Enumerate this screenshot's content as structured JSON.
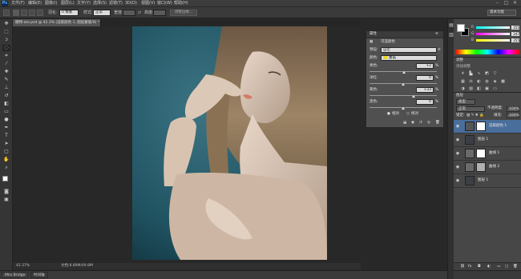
{
  "app": {
    "logo": "Ps"
  },
  "menu": [
    "文件(F)",
    "编辑(E)",
    "图像(I)",
    "图层(L)",
    "文字(Y)",
    "选择(S)",
    "滤镜(T)",
    "3D(D)",
    "视图(V)",
    "窗口(W)",
    "帮助(H)"
  ],
  "window_controls": {
    "minimize": "–",
    "maximize": "□",
    "close": "✕"
  },
  "options": {
    "feather_label": "羽化:",
    "feather_value": "0 像素",
    "style_label": "样式:",
    "style_value": "正常",
    "width_label": "宽度:",
    "height_label": "高度:",
    "refine_edge": "调整边缘...",
    "workspace": "基本功能"
  },
  "document": {
    "tab_title": "模特-ato.psd @ 42.3% (选取颜色 1, 图层蒙版/8) *",
    "zoom": "42.37%",
    "doc_info": "文档:8.89M/49.8M"
  },
  "bottom_tabs": [
    "Mini Bridge",
    "时间轴"
  ],
  "properties": {
    "panel_title": "属性",
    "adjustment_name": "可选颜色",
    "preset_label": "预设:",
    "preset_value": "自定",
    "colors_label": "颜色:",
    "colors_value": "黄色",
    "colors_swatch": "#e8d820",
    "sliders": [
      {
        "label": "青色:",
        "value": "+2",
        "unit": "%",
        "fraction": 0.51
      },
      {
        "label": "洋红:",
        "value": "0",
        "unit": "%",
        "fraction": 0.5
      },
      {
        "label": "黄色:",
        "value": "+33",
        "unit": "%",
        "fraction": 0.66
      },
      {
        "label": "黑色:",
        "value": "0",
        "unit": "%",
        "fraction": 0.5
      }
    ],
    "method_relative": "相对",
    "method_absolute": "绝对"
  },
  "color_panel": {
    "sliders": [
      {
        "label": "R",
        "value": "255",
        "gradient": "linear-gradient(to right,#00ffff,#ffffff)"
      },
      {
        "label": "G",
        "value": "247",
        "gradient": "linear-gradient(to right,#ff00ff,#ffffff)"
      },
      {
        "label": "B",
        "value": "255",
        "gradient": "linear-gradient(to right,#ffff00,#ffffff)"
      }
    ],
    "foreground": "#ffffff",
    "background": "#000000"
  },
  "adjustments_panel": {
    "tab": "调整",
    "subtitle": "添加调整"
  },
  "layers_panel": {
    "tab": "图层",
    "kind_label": "类型",
    "blend_mode": "正常",
    "opacity_label": "不透明度:",
    "opacity_value": "100%",
    "lock_label": "锁定:",
    "fill_label": "填充:",
    "fill_value": "100%",
    "layers": [
      {
        "name": "选取颜色 1",
        "thumb": "#555555",
        "mask": "#ffffff",
        "selected": true
      },
      {
        "name": "图层 1",
        "thumb": "#3b3f44",
        "mask": "",
        "selected": false
      },
      {
        "name": "曲线 1",
        "thumb": "#6a6a6a",
        "mask": "#ffffff",
        "selected": false
      },
      {
        "name": "曲线 2",
        "thumb": "#6a6a6a",
        "mask": "#b0b0b0",
        "selected": false
      },
      {
        "name": "图层 1",
        "thumb": "#3b3f44",
        "mask": "",
        "selected": false
      }
    ]
  },
  "accent_color": "#4a6e9b"
}
